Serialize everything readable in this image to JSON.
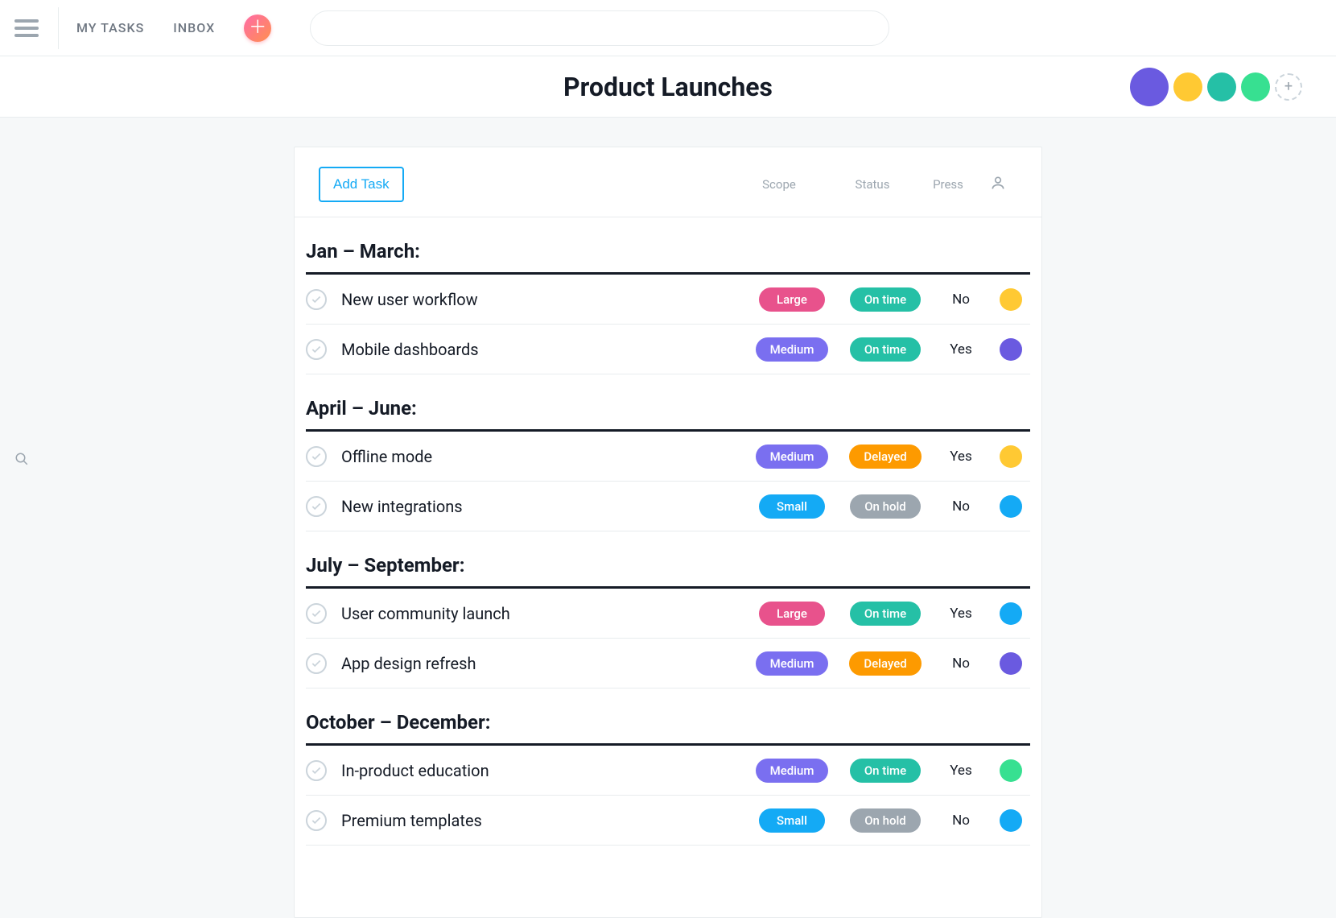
{
  "nav": {
    "my_tasks": "MY TASKS",
    "inbox": "INBOX"
  },
  "search": {
    "placeholder": ""
  },
  "project": {
    "title": "Product Launches"
  },
  "collaborators": [
    {
      "color": "#6a5ae0"
    },
    {
      "color": "#ffc933"
    },
    {
      "color": "#25c0a6"
    },
    {
      "color": "#37e091"
    }
  ],
  "panel": {
    "add_task_label": "Add Task",
    "columns": {
      "scope": "Scope",
      "status": "Status",
      "press": "Press"
    }
  },
  "scope_labels": {
    "large": "Large",
    "medium": "Medium",
    "small": "Small"
  },
  "status_labels": {
    "ontime": "On time",
    "delayed": "Delayed",
    "onhold": "On hold"
  },
  "sections": [
    {
      "title": "Jan – March:",
      "tasks": [
        {
          "name": "New user workflow",
          "scope": "large",
          "status": "ontime",
          "press": "No",
          "assignee_color": "#ffc933"
        },
        {
          "name": "Mobile dashboards",
          "scope": "medium",
          "status": "ontime",
          "press": "Yes",
          "assignee_color": "#6a5ae0"
        }
      ]
    },
    {
      "title": "April – June:",
      "tasks": [
        {
          "name": "Offline mode",
          "scope": "medium",
          "status": "delayed",
          "press": "Yes",
          "assignee_color": "#ffc933"
        },
        {
          "name": "New integrations",
          "scope": "small",
          "status": "onhold",
          "press": "No",
          "assignee_color": "#14aaf5"
        }
      ]
    },
    {
      "title": "July – September:",
      "tasks": [
        {
          "name": "User community launch",
          "scope": "large",
          "status": "ontime",
          "press": "Yes",
          "assignee_color": "#14aaf5"
        },
        {
          "name": "App design refresh",
          "scope": "medium",
          "status": "delayed",
          "press": "No",
          "assignee_color": "#6a5ae0"
        }
      ]
    },
    {
      "title": "October – December:",
      "tasks": [
        {
          "name": "In-product education",
          "scope": "medium",
          "status": "ontime",
          "press": "Yes",
          "assignee_color": "#37e091"
        },
        {
          "name": "Premium templates",
          "scope": "small",
          "status": "onhold",
          "press": "No",
          "assignee_color": "#14aaf5"
        }
      ]
    }
  ]
}
